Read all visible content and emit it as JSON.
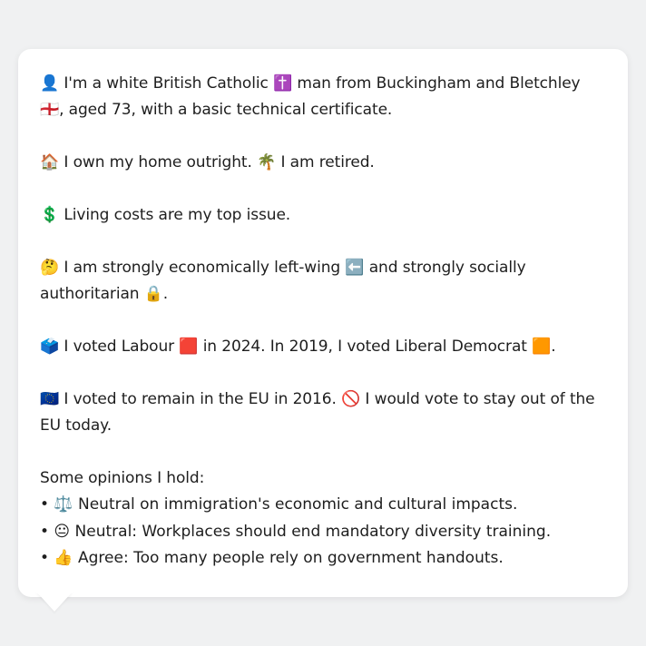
{
  "persona": {
    "intro": "👤 I'm a white British Catholic ✝️ man from Buckingham and Bletchley 🏴󠁧󠁢󠁥󠁮󠁧󠁿, aged 73, with a basic technical certificate.",
    "housing": "🏠 I own my home outright. 🌴 I am retired.",
    "issue": "💲 Living costs are my top issue.",
    "ideology": "🤔 I am strongly economically left-wing ⬅️ and strongly socially authoritarian 🔒.",
    "votes": "🗳️ I voted Labour 🟥 in 2024. In 2019, I voted Liberal Democrat 🟧.",
    "brexit": "🇪🇺 I voted to remain in the EU in 2016. 🚫 I would vote to stay out of the EU today.",
    "opinions_heading": "Some opinions I hold:",
    "opinions": [
      "• ⚖️ Neutral on immigration's economic and cultural impacts.",
      "• 😐 Neutral: Workplaces should end mandatory diversity training.",
      "• 👍 Agree: Too many people rely on government handouts."
    ]
  }
}
